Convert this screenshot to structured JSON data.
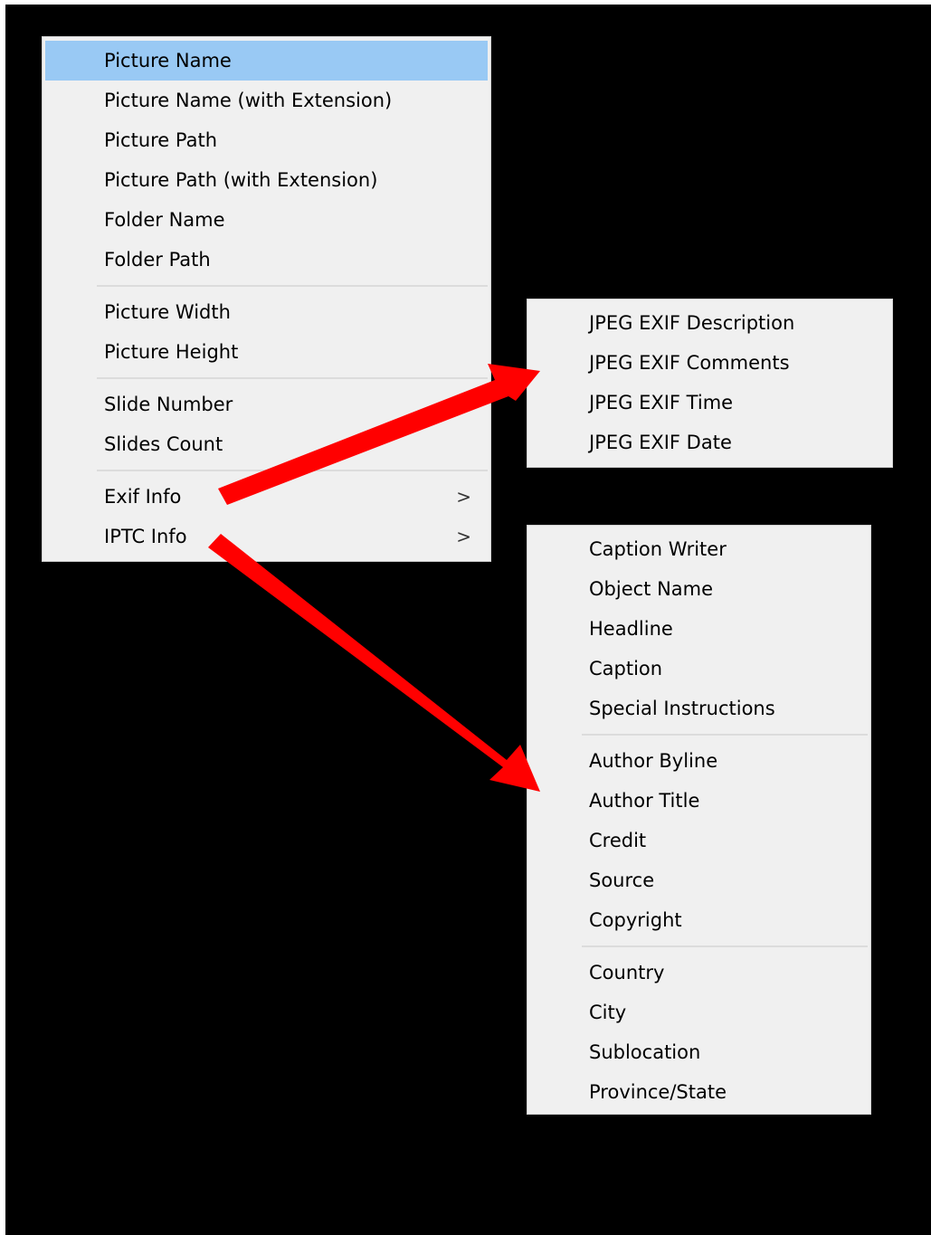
{
  "main_menu": {
    "groups": [
      [
        "Picture Name",
        "Picture Name (with Extension)",
        "Picture Path",
        "Picture Path (with Extension)",
        "Folder Name",
        "Folder Path"
      ],
      [
        "Picture Width",
        "Picture Height"
      ],
      [
        "Slide Number",
        "Slides Count"
      ]
    ],
    "exif_label": "Exif Info",
    "iptc_label": "IPTC Info",
    "submenu_glyph": ">",
    "highlighted_item": "Picture Name",
    "highlight_color": "#99c9f4"
  },
  "exif_submenu": {
    "items": [
      "JPEG EXIF Description",
      "JPEG EXIF Comments",
      "JPEG EXIF Time",
      "JPEG EXIF Date"
    ]
  },
  "iptc_submenu": {
    "groups": [
      [
        "Caption Writer",
        "Object Name",
        "Headline",
        "Caption",
        "Special Instructions"
      ],
      [
        "Author Byline",
        "Author Title",
        "Credit",
        "Source",
        "Copyright"
      ],
      [
        "Country",
        "City",
        "Sublocation",
        "Province/State"
      ]
    ]
  },
  "annotations": {
    "arrow_color": "#ff0000",
    "arrows": [
      {
        "from": "Exif Info",
        "to": "exif-submenu"
      },
      {
        "from": "IPTC Info",
        "to": "iptc-submenu"
      }
    ]
  },
  "colors": {
    "background": "#000000",
    "menu_background": "#f0f0f0",
    "separator": "#dcdcdc"
  }
}
